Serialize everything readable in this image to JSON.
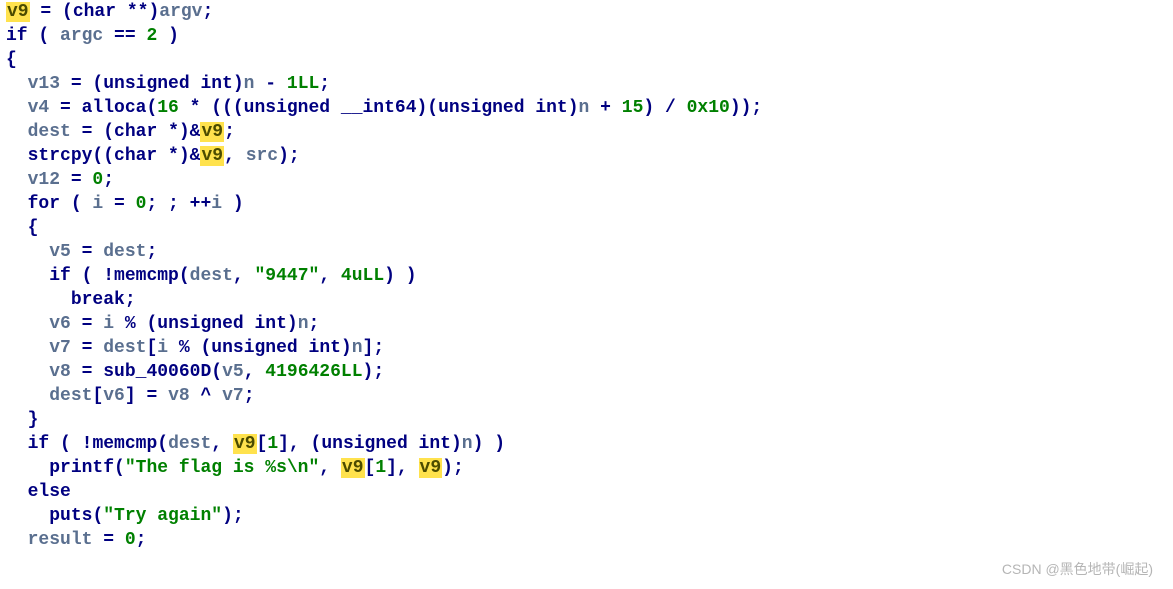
{
  "watermark": "CSDN @黑色地带(崛起)",
  "code": {
    "l01": {
      "v9": "v9",
      "eq": " = (",
      "typ": "char",
      "rest1": " **)",
      "argv": "argv",
      "semi": ";"
    },
    "l02": {
      "if": "if",
      "p1": " ( ",
      "argc": "argc",
      "cond": " == ",
      "two": "2",
      "p2": " )"
    },
    "l03": {
      "b": "{"
    },
    "l04": {
      "v13": "v13",
      "txt1": " = (",
      "uint": "unsigned int",
      "txt2": ")",
      "n": "n",
      "txt3": " - ",
      "num": "1LL",
      "semi": ";"
    },
    "l05": {
      "v4": "v4",
      "eq": " = ",
      "fn": "alloca",
      "p1": "(",
      "n16": "16",
      "txt1": " * (((",
      "u64": "unsigned __int64",
      "txt2": ")(",
      "uint": "unsigned int",
      "txt3": ")",
      "n": "n",
      "txt4": " + ",
      "n15": "15",
      "txt5": ") / ",
      "hex": "0x10",
      "txt6": "));"
    },
    "l06": {
      "dest": "dest",
      "eq": " = (",
      "typ": "char",
      "txt1": " *)&",
      "v9": "v9",
      "semi": ";"
    },
    "l07": {
      "fn": "strcpy",
      "p1": "((",
      "typ": "char",
      "txt1": " *)&",
      "v9": "v9",
      "c": ", ",
      "src": "src",
      "p2": ");"
    },
    "l08": {
      "v12": "v12",
      "eq": " = ",
      "zero": "0",
      "semi": ";"
    },
    "l09": {
      "for": "for",
      "p1": " ( ",
      "i": "i",
      "eq": " = ",
      "zero": "0",
      "txt1": "; ; ++",
      "i2": "i",
      "p2": " )"
    },
    "l10": {
      "b": "{"
    },
    "l11": {
      "v5": "v5",
      "eq": " = ",
      "dest": "dest",
      "semi": ";"
    },
    "l12": {
      "if": "if",
      "p1": " ( !",
      "fn": "memcmp",
      "p2": "(",
      "dest": "dest",
      "c": ", ",
      "str": "\"9447\"",
      "c2": ", ",
      "num": "4uLL",
      "p3": ") )"
    },
    "l13": {
      "brk": "break",
      ";": ";"
    },
    "l14": {
      "v6": "v6",
      "eq": " = ",
      "i": "i",
      "mod": " % (",
      "uint": "unsigned int",
      "txt1": ")",
      "n": "n",
      "semi": ";"
    },
    "l15": {
      "v7": "v7",
      "eq": " = ",
      "dest": "dest",
      "br1": "[",
      "i": "i",
      "mod": " % (",
      "uint": "unsigned int",
      "txt1": ")",
      "n": "n",
      "br2": "];"
    },
    "l16": {
      "v8": "v8",
      "eq": " = ",
      "fn": "sub_40060D",
      "p1": "(",
      "v5": "v5",
      "c": ", ",
      "num": "4196426LL",
      "p2": ");"
    },
    "l17": {
      "dest": "dest",
      "br1": "[",
      "v6": "v6",
      "br2": "] = ",
      "v8": "v8",
      "xor": " ^ ",
      "v7": "v7",
      "semi": ";"
    },
    "l18": {
      "b": "}"
    },
    "l19": {
      "if": "if",
      "p1": " ( !",
      "fn": "memcmp",
      "p2": "(",
      "dest": "dest",
      "c": ", ",
      "v9": "v9",
      "idx": "[",
      "one": "1",
      "idx2": "], (",
      "uint": "unsigned int",
      "txt1": ")",
      "n": "n",
      "p3": ") )"
    },
    "l20": {
      "fn": "printf",
      "p1": "(",
      "str": "\"The flag is %s\\n\"",
      "c": ", ",
      "v9a": "v9",
      "idx": "[",
      "one": "1",
      "idx2": "], ",
      "v9b": "v9",
      "p2": ");"
    },
    "l21": {
      "else": "else"
    },
    "l22": {
      "fn": "puts",
      "p1": "(",
      "str": "\"Try again\"",
      "p2": ");"
    },
    "l23": {
      "result": "result",
      "eq": " = ",
      "zero": "0",
      "semi": ";"
    }
  }
}
